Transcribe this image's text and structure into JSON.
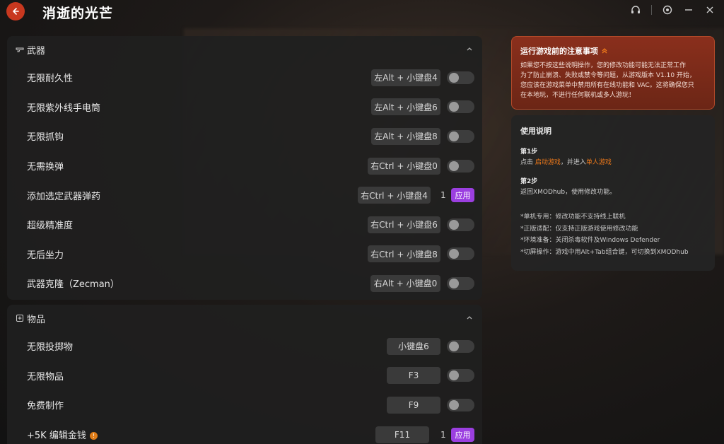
{
  "app": {
    "game_title": "消逝的光芒"
  },
  "weapons": {
    "section_label": "武器",
    "rows": [
      {
        "label": "无限耐久性",
        "hotkey": "左Alt + 小键盘4"
      },
      {
        "label": "无限紫外线手电筒",
        "hotkey": "左Alt + 小键盘6"
      },
      {
        "label": "无限抓钩",
        "hotkey": "左Alt + 小键盘8"
      },
      {
        "label": "无需换弹",
        "hotkey": "右Ctrl + 小键盘0"
      },
      {
        "label": "添加选定武器弹药",
        "hotkey": "右Ctrl + 小键盘4",
        "quantity": "1",
        "apply": "应用"
      },
      {
        "label": "超级精准度",
        "hotkey": "右Ctrl + 小键盘6"
      },
      {
        "label": "无后坐力",
        "hotkey": "右Ctrl + 小键盘8"
      },
      {
        "label": "武器克隆（Zecman）",
        "hotkey": "右Alt + 小键盘0"
      }
    ]
  },
  "items": {
    "section_label": "物品",
    "rows": [
      {
        "label": "无限投掷物",
        "hotkey": "小键盘6"
      },
      {
        "label": "无限物品",
        "hotkey": "F3"
      },
      {
        "label": "免费制作",
        "hotkey": "F9"
      },
      {
        "label": "+5K 编辑金钱",
        "hotkey": "F11",
        "quantity": "1",
        "apply": "应用",
        "info_icon": "!"
      }
    ]
  },
  "notice": {
    "title": "运行游戏前的注意事项",
    "lines": [
      "如果您不按这些说明操作，您的修改功能可能无法正常工作",
      "为了防止崩溃、失败或禁令等问题，从游戏版本 V1.10 开始，",
      "您应该在游戏菜单中禁用所有在线功能和 VAC。这将确保您只",
      "在本地玩，不进行任何联机或多人游玩！"
    ]
  },
  "guide": {
    "title": "使用说明",
    "step1_title": "第1步",
    "step1_prefix": "点击 ",
    "step1_link1": "启动游戏",
    "step1_middle": "，并进入",
    "step1_link2": "单人游戏",
    "step2_title": "第2步",
    "step2_text": "返回XMODhub，使用修改功能。",
    "notes": [
      "*单机专用：修改功能不支持线上联机",
      "*正版适配：仅支持正版游戏使用修改功能",
      "*环境准备：关闭杀毒软件及Windows Defender",
      "*切屏操作：游戏中用Alt+Tab组合键，可切换到XMODhub"
    ]
  },
  "colors": {
    "accent_orange": "#f07a1a",
    "apply_purple": "#9b3fe0",
    "notice_red": "#8a2f1c"
  }
}
